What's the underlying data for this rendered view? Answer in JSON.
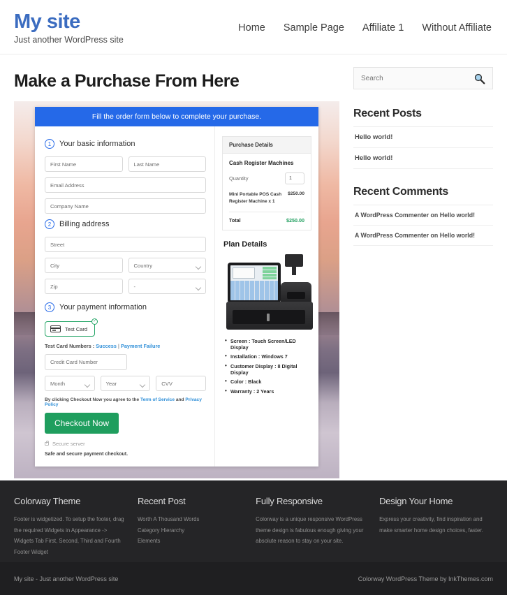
{
  "header": {
    "site_title": "My site",
    "tagline": "Just another WordPress site",
    "nav": [
      {
        "label": "Home"
      },
      {
        "label": "Sample Page"
      },
      {
        "label": "Affiliate 1"
      },
      {
        "label": "Without Affiliate"
      }
    ]
  },
  "main": {
    "page_title": "Make a Purchase From Here",
    "banner": "Fill the order form below to complete your purchase.",
    "steps": {
      "one_num": "1",
      "one_label": "Your basic information",
      "two_num": "2",
      "two_label": "Billing address",
      "three_num": "3",
      "three_label": "Your payment information"
    },
    "fields": {
      "first_name": "First Name",
      "last_name": "Last Name",
      "email": "Email Address",
      "company": "Company Name",
      "street": "Street",
      "city": "City",
      "country": "Country",
      "zip": "Zip",
      "state": "-",
      "credit_card": "Credit Card Number",
      "month": "Month",
      "year": "Year",
      "cvv": "CVV"
    },
    "payment": {
      "chip_label": "Test Card",
      "chip_check": "✓",
      "test_prefix": "Test Card Numbers : ",
      "test_success": "Success",
      "test_sep": " | ",
      "test_failure": "Payment Failure",
      "terms_prefix": "By clicking Checkout Now you agree to the ",
      "terms_tos": "Term of Service",
      "terms_and": " and ",
      "terms_privacy": "Privacy Policy",
      "checkout_label": "Checkout Now",
      "secure_server": "Secure server",
      "safe_note": "Safe and secure payment checkout."
    },
    "purchase_details": {
      "heading": "Purchase Details",
      "product": "Cash Register Machines",
      "qty_label": "Quantity",
      "qty_value": "1",
      "line_item": "Mini Portable POS Cash Register Machine x 1",
      "line_amount": "$250.00",
      "total_label": "Total",
      "total_amount": "$250.00"
    },
    "plan": {
      "heading": "Plan Details",
      "specs": [
        "Screen : Touch Screen/LED Display",
        "Installation : Windows 7",
        "Customer Display : 8 Digital Display",
        "Color : Black",
        "Warranty : 2 Years"
      ]
    }
  },
  "sidebar": {
    "search_placeholder": "Search",
    "recent_posts_title": "Recent Posts",
    "recent_posts": [
      {
        "label": "Hello world!"
      },
      {
        "label": "Hello world!"
      }
    ],
    "recent_comments_title": "Recent Comments",
    "recent_comments": [
      {
        "label": "A WordPress Commenter on Hello world!"
      },
      {
        "label": "A WordPress Commenter on Hello world!"
      }
    ]
  },
  "footer": {
    "columns": [
      {
        "title": "Colorway Theme",
        "text": "Footer is widgetized. To setup the footer, drag the required Widgets in Appearance -> Widgets Tab First, Second, Third and Fourth Footer Widget"
      },
      {
        "title": "Recent Post",
        "items": [
          {
            "label": "Worth A Thousand Words"
          },
          {
            "label": "Category Hierarchy"
          },
          {
            "label": "Elements"
          }
        ]
      },
      {
        "title": "Fully Responsive",
        "text": "Colorway is a unique responsive WordPress theme design is fabulous enough giving your absolute reason to stay on your site."
      },
      {
        "title": "Design Your Home",
        "text": "Express your creativity, find inspiration and make smarter home design choices, faster."
      }
    ],
    "copyright_left": "My site - Just another WordPress site",
    "copyright_right": "Colorway WordPress Theme by InkThemes.com"
  },
  "colors": {
    "brand_blue": "#3b6cc0",
    "banner_blue": "#2569e8",
    "green": "#1f9e5e",
    "link_blue": "#2f8fd8",
    "footer_dark": "#252527"
  }
}
